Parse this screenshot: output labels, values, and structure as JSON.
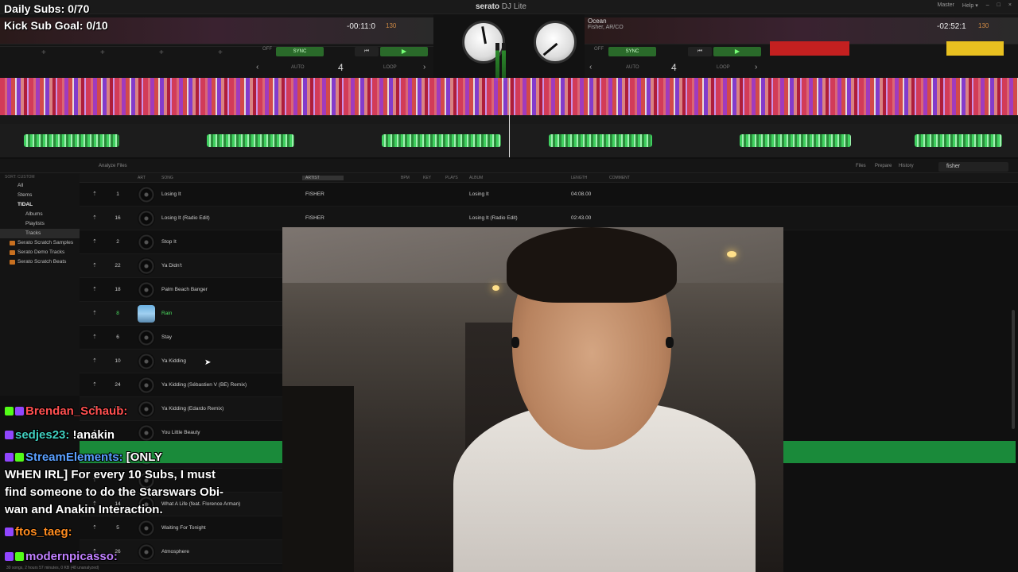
{
  "overlay": {
    "daily_subs": "Daily Subs: 0/70",
    "kick_goal": "Kick Sub Goal: 0/10"
  },
  "app": {
    "brand": "serato",
    "edition": "DJ Lite"
  },
  "topbar": {
    "master": "Master",
    "help": "Help ▾"
  },
  "deck_left": {
    "time": "-00:11:0",
    "bpm": "130",
    "sync": "SYNC",
    "off": "OFF",
    "auto": "AUTO",
    "loop": "LOOP",
    "loop_len": "4"
  },
  "deck_right": {
    "title": "Ocean",
    "artist": "Fisher, AR/CO",
    "time": "-02:52:1",
    "bpm": "130",
    "sync": "SYNC",
    "off": "OFF",
    "auto": "AUTO",
    "loop": "LOOP",
    "loop_len": "4"
  },
  "library": {
    "analyze": "Analyze Files",
    "tabs": [
      "Files",
      "Prepare",
      "History"
    ],
    "search": "fisher",
    "sidebar_header": "SORT: CUSTOM",
    "sidebar": [
      {
        "label": "All",
        "kind": "item"
      },
      {
        "label": "Stems",
        "kind": "item"
      },
      {
        "label": "TIDAL",
        "kind": "tidal"
      },
      {
        "label": "Albums",
        "kind": "sub"
      },
      {
        "label": "Playlists",
        "kind": "sub"
      },
      {
        "label": "Tracks",
        "kind": "sub-sel"
      },
      {
        "label": "Serato Scratch Samples",
        "kind": "crate"
      },
      {
        "label": "Serato Demo Tracks",
        "kind": "crate"
      },
      {
        "label": "Serato Scratch Beats",
        "kind": "crate"
      }
    ],
    "columns": {
      "art": "ART",
      "song": "SONG",
      "artist": "ARTIST",
      "bpm": "BPM",
      "key": "KEY",
      "plays": "PLAYS",
      "album": "ALBUM",
      "length": "LENGTH",
      "comment": "COMMENT"
    },
    "rows": [
      {
        "num": "1",
        "song": "Losing It",
        "artist": "FISHER",
        "album": "Losing It",
        "length": "04:08.00"
      },
      {
        "num": "16",
        "song": "Losing It (Radio Edit)",
        "artist": "FISHER",
        "album": "Losing It (Radio Edit)",
        "length": "02:43.00"
      },
      {
        "num": "2",
        "song": "Stop It"
      },
      {
        "num": "22",
        "song": "Ya Didn't"
      },
      {
        "num": "18",
        "song": "Palm Beach Banger"
      },
      {
        "num": "8",
        "song": "Rain",
        "playing": true
      },
      {
        "num": "6",
        "song": "Stay"
      },
      {
        "num": "10",
        "song": "Ya Kidding"
      },
      {
        "num": "24",
        "song": "Ya Kidding (Sébastien V (BE) Remix)"
      },
      {
        "num": "23",
        "song": "Ya Kidding (Edardo Remix)"
      },
      {
        "num": "",
        "song": "You Little Beauty"
      },
      {
        "num": "3",
        "song": "Ocean"
      },
      {
        "num": "",
        "song": ""
      },
      {
        "num": "14",
        "song": "What A Life (feat. Florence Arman)"
      },
      {
        "num": "5",
        "song": "Waiting For Tonight"
      },
      {
        "num": "26",
        "song": "Atmosphere"
      }
    ],
    "status": "30 songs, 2 hours 57 minutes, 0 KB (48 unanalyzed)"
  },
  "chat": [
    {
      "name": "Brendan_Schaub:",
      "text": "",
      "color": "#ff5050"
    },
    {
      "name": "sedjes23:",
      "text": " !anakin",
      "color": "#40d0c0"
    },
    {
      "name": "StreamElements:",
      "text": " [ONLY",
      "color": "#5aa0ff"
    },
    {
      "name": "",
      "text": "WHEN IRL] For every 10 Subs, I must",
      "color": ""
    },
    {
      "name": "",
      "text": "find someone to do the Starswars Obi-",
      "color": ""
    },
    {
      "name": "",
      "text": "wan and Anakin Interaction.",
      "color": ""
    },
    {
      "name": "ftos_taeg:",
      "text": "",
      "color": "#ff8c20"
    },
    {
      "name": "modernpicasso:",
      "text": "",
      "color": "#c080ff"
    }
  ]
}
